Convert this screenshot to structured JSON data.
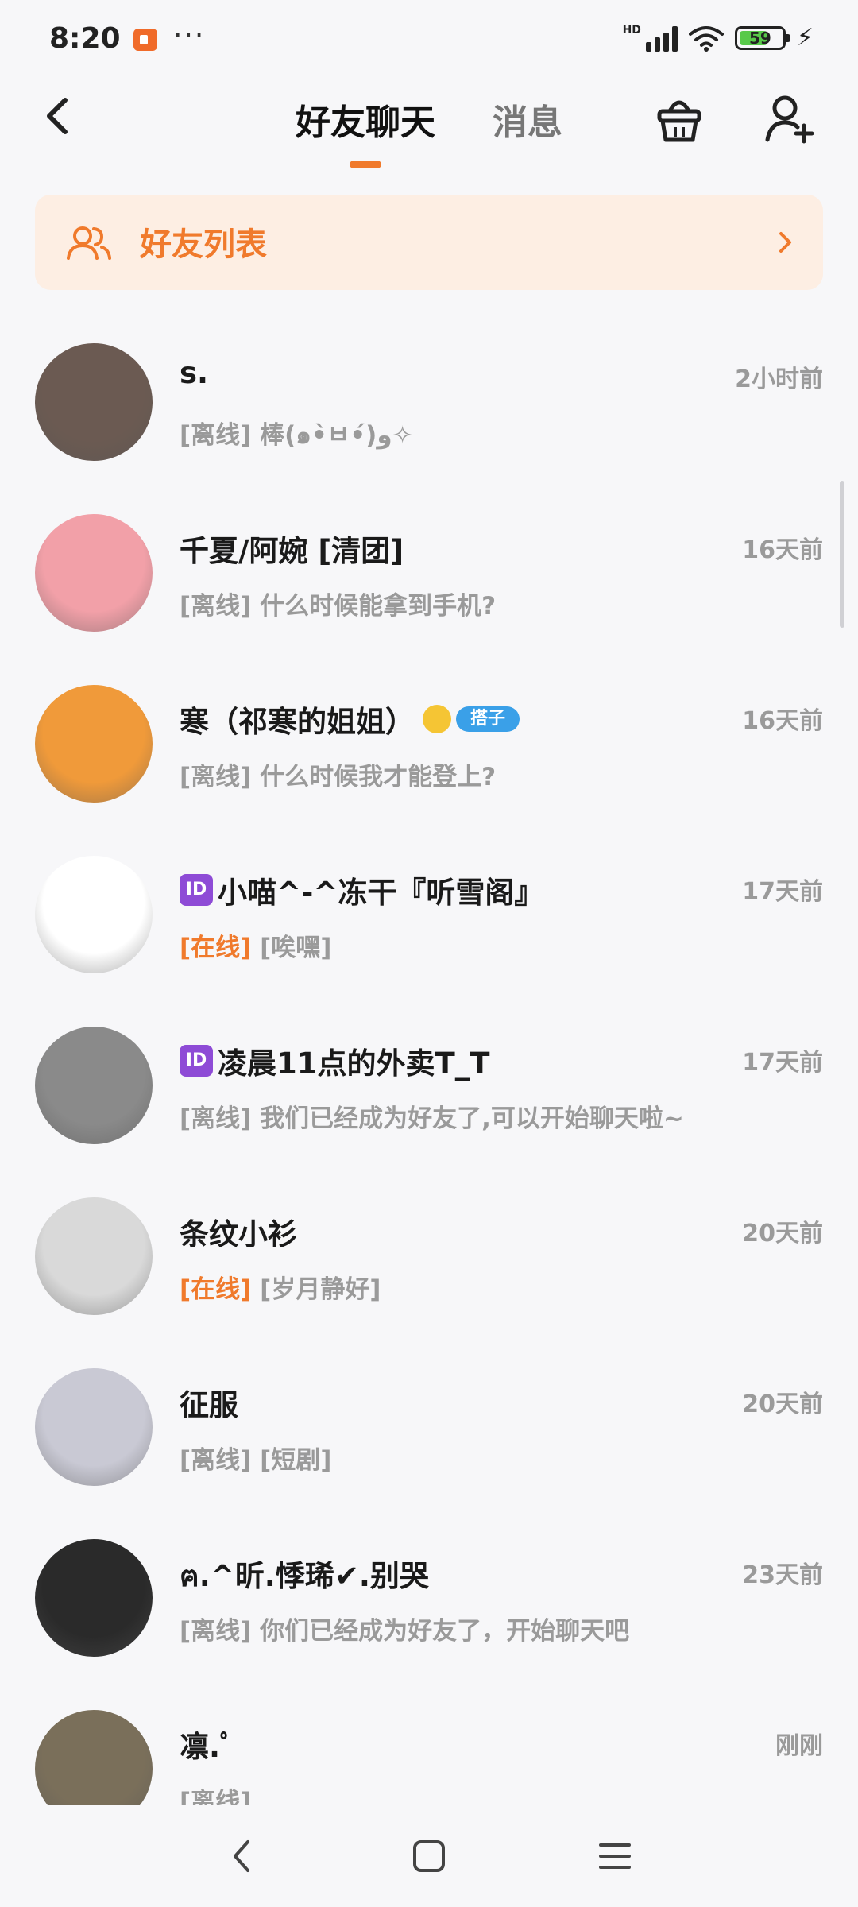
{
  "status_bar": {
    "time": "8:20",
    "dots": "···",
    "hd": "HD",
    "battery": "59"
  },
  "header": {
    "tab_active": "好友聊天",
    "tab_inactive": "消息"
  },
  "friend_list_bar": {
    "label": "好友列表"
  },
  "chats": [
    {
      "name": "s.",
      "time": "2小时前",
      "status": "[离线]",
      "online": false,
      "message": "棒(๑•̀ㅂ•́)و✧",
      "avatar_color": "#6b5a52",
      "badge": null
    },
    {
      "name": "千夏/阿婉 [清团]",
      "time": "16天前",
      "status": "[离线]",
      "online": false,
      "message": "什么时候能拿到手机?",
      "avatar_color": "#f2a0a8",
      "badge": null
    },
    {
      "name": "寒（祁寒的姐姐）",
      "time": "16天前",
      "status": "[离线]",
      "online": false,
      "message": "什么时候我才能登上?",
      "avatar_color": "#f09a3a",
      "badge": "搭子"
    },
    {
      "name": "小喵^-^冻干『听雪阁』",
      "time": "17天前",
      "status": "[在线]",
      "online": true,
      "message": "[唉嘿]",
      "avatar_color": "#ffffff",
      "badge": "ID"
    },
    {
      "name": "凌晨11点的外卖T_T",
      "time": "17天前",
      "status": "[离线]",
      "online": false,
      "message": "我们已经成为好友了,可以开始聊天啦~",
      "avatar_color": "#8a8a8a",
      "badge": "ID"
    },
    {
      "name": "条纹小衫",
      "time": "20天前",
      "status": "[在线]",
      "online": true,
      "message": "[岁月静好]",
      "avatar_color": "#d9d9d9",
      "badge": null
    },
    {
      "name": "征服",
      "time": "20天前",
      "status": "[离线]",
      "online": false,
      "message": "[短剧]",
      "avatar_color": "#c9c9d4",
      "badge": null
    },
    {
      "name": "ฅ.^昕.悸琋✔.别哭",
      "time": "23天前",
      "status": "[离线]",
      "online": false,
      "message": "你们已经成为好友了，开始聊天吧",
      "avatar_color": "#2a2a2a",
      "badge": null
    },
    {
      "name": "凛.ﾟ",
      "time": "刚刚",
      "status": "[离线]",
      "online": false,
      "message": "",
      "avatar_color": "#7a6f5a",
      "badge": null
    }
  ]
}
